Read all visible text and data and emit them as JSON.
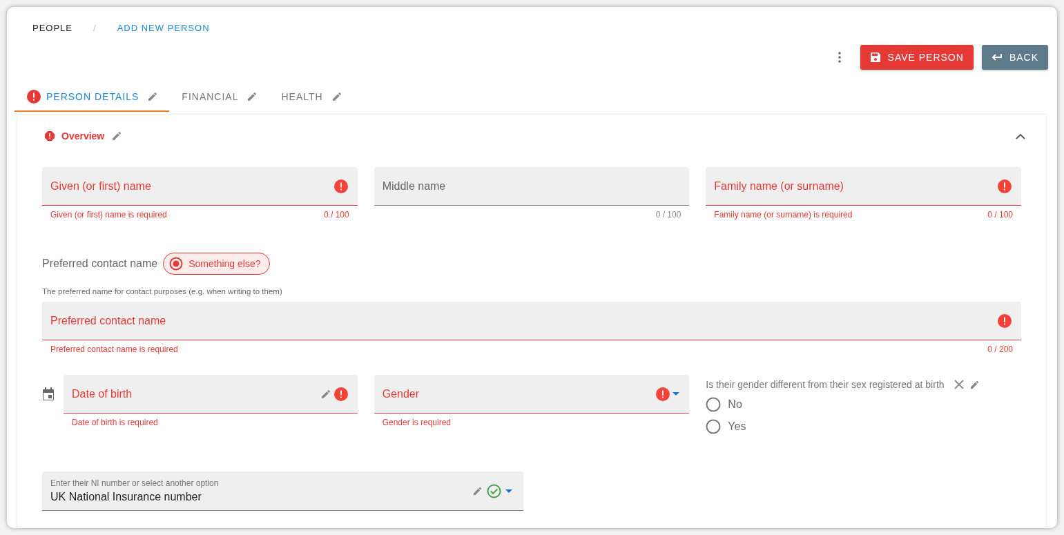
{
  "breadcrumb_separator": "/",
  "breadcrumbs": [
    {
      "label": "PEOPLE",
      "selected": false
    },
    {
      "label": "ADD NEW PERSON",
      "selected": true
    }
  ],
  "actions": [
    {
      "kind": "save",
      "label": "SAVE PERSON"
    },
    {
      "kind": "back",
      "label": "BACK"
    }
  ],
  "tabs": [
    {
      "label": "PERSON DETAILS",
      "selected": true,
      "error": true
    },
    {
      "label": "FINANCIAL",
      "selected": false,
      "error": false
    },
    {
      "label": "HEALTH",
      "selected": false,
      "error": false
    }
  ],
  "section": {
    "title": "Overview",
    "error": true,
    "expanded": true
  },
  "name_fields": [
    {
      "label": "Given (or first) name",
      "error": true,
      "hint": "Given (or first) name is required",
      "counter": "0 / 100"
    },
    {
      "label": "Middle name",
      "error": false,
      "counter": "0 / 100"
    },
    {
      "label": "Family name (or surname)",
      "error": true,
      "hint": "Family name (or surname) is required",
      "counter": "0 / 100"
    }
  ],
  "preferred": {
    "label": "Preferred contact name",
    "chip": {
      "label": "Something else?",
      "selected": true
    },
    "description": "The preferred name for contact purposes (e.g. when writing to them)",
    "field": {
      "label": "Preferred contact name",
      "error": true,
      "hint": "Preferred contact name is required",
      "counter": "0 / 200"
    }
  },
  "dob": {
    "label": "Date of birth",
    "error": true,
    "hint": "Date of birth is required"
  },
  "gender": {
    "label": "Gender",
    "error": true,
    "hint": "Gender is required"
  },
  "gender_question": {
    "label": "Is their gender different from their sex registered at birth",
    "options": [
      {
        "label": "No",
        "selected": false
      },
      {
        "label": "Yes",
        "selected": false
      }
    ]
  },
  "ni": {
    "label": "Enter their NI number or select another option",
    "value": "UK National Insurance number",
    "valid": true
  }
}
